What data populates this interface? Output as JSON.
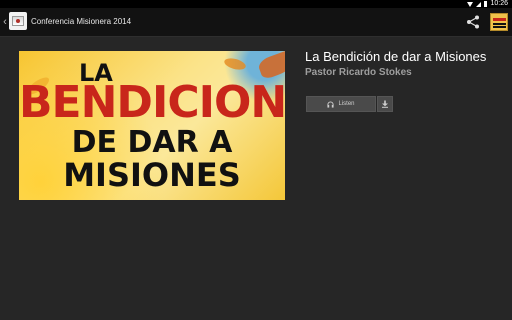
{
  "status_bar": {
    "time": "10:26",
    "icons": [
      "wifi-icon",
      "signal-icon",
      "battery-icon"
    ]
  },
  "action_bar": {
    "back_icon": "chevron-left-icon",
    "back_glyph": "‹",
    "app_icon": "app-icon",
    "title": "Conferencia Misionera 2014",
    "share_icon": "share-icon",
    "thumbnail_icon": "thumbnail-icon"
  },
  "artwork": {
    "line1": "LA",
    "line2": "BENDICION",
    "line3": "DE DAR A",
    "line4": "MISIONES",
    "colors": {
      "accent": "#c8261b",
      "background": "#f7c531"
    }
  },
  "detail": {
    "title": "La Bendición de dar a Misiones",
    "speaker": "Pastor Ricardo Stokes",
    "listen_label": "Listen",
    "listen_icon": "headphones-icon",
    "download_icon": "download-icon"
  },
  "colors": {
    "background": "#262626",
    "action_bar": "#121212",
    "button": "#4a4a4a",
    "subtitle": "#9e9e9e"
  }
}
